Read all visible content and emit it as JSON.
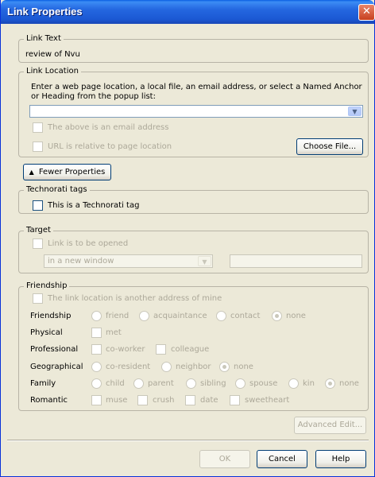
{
  "window": {
    "title": "Link Properties",
    "close_glyph": "✕"
  },
  "link_text": {
    "legend": "Link Text",
    "value": "review of Nvu"
  },
  "link_location": {
    "legend": "Link Location",
    "instructions": "Enter a web page location, a local file, an email address, or select a Named Anchor or Heading from the popup list:",
    "url_value": "",
    "email_checkbox_label": "The above is an email address",
    "relative_checkbox_label": "URL is relative to page location",
    "choose_file_label": "Choose File..."
  },
  "fewer_properties": {
    "arrow": "▲",
    "label": "Fewer Properties"
  },
  "technorati": {
    "legend": "Technorati tags",
    "checkbox_label": "This is a Technorati tag"
  },
  "target": {
    "legend": "Target",
    "checkbox_label": "Link is to be opened",
    "selected_option": "in a new window",
    "frame_value": ""
  },
  "friendship": {
    "legend": "Friendship",
    "another_address_label": "The link location is another address of mine",
    "rows": {
      "friendship": {
        "label": "Friendship",
        "options": [
          "friend",
          "acquaintance",
          "contact",
          "none"
        ]
      },
      "physical": {
        "label": "Physical",
        "options": [
          "met"
        ]
      },
      "professional": {
        "label": "Professional",
        "options": [
          "co-worker",
          "colleague"
        ]
      },
      "geographical": {
        "label": "Geographical",
        "options": [
          "co-resident",
          "neighbor",
          "none"
        ]
      },
      "family": {
        "label": "Family",
        "options": [
          "child",
          "parent",
          "sibling",
          "spouse",
          "kin",
          "none"
        ]
      },
      "romantic": {
        "label": "Romantic",
        "options": [
          "muse",
          "crush",
          "date",
          "sweetheart"
        ]
      }
    }
  },
  "buttons": {
    "advanced_edit": "Advanced Edit...",
    "ok": "OK",
    "cancel": "Cancel",
    "help": "Help"
  }
}
